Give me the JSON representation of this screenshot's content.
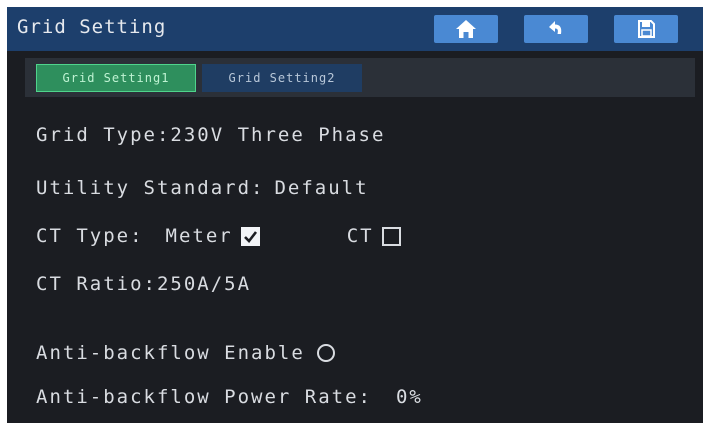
{
  "header": {
    "title": "Grid Setting",
    "buttons": [
      {
        "icon": "home-icon"
      },
      {
        "icon": "back-arrow-icon"
      },
      {
        "icon": "save-icon"
      }
    ]
  },
  "tabs": [
    {
      "label": "Grid Setting1",
      "active": true
    },
    {
      "label": "Grid Setting2",
      "active": false
    }
  ],
  "settings": {
    "grid_type_label": "Grid Type:",
    "grid_type_value": "230V Three Phase",
    "utility_standard_label": "Utility Standard:",
    "utility_standard_value": "Default",
    "ct_type_label": "CT Type:",
    "ct_type_options": [
      {
        "label": "Meter",
        "checked": true
      },
      {
        "label": "CT",
        "checked": false
      }
    ],
    "ct_ratio_label": "CT Ratio:",
    "ct_ratio_value": "250A/5A",
    "anti_backflow_enable_label": "Anti-backflow Enable",
    "anti_backflow_enable_value": false,
    "anti_backflow_power_rate_label": "Anti-backflow Power Rate:",
    "anti_backflow_power_rate_value": "0%"
  },
  "colors": {
    "header_bg": "#1d3f6c",
    "screen_bg": "#1b1d22",
    "button_blue": "#4a89d3",
    "active_tab": "#2e8f5d",
    "inactive_tab": "#1f3d63"
  }
}
